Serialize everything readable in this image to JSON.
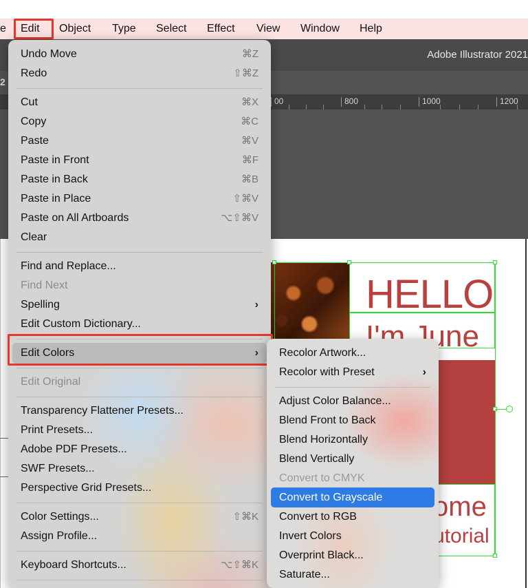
{
  "menubar": {
    "items": [
      {
        "label": "e"
      },
      {
        "label": "Edit"
      },
      {
        "label": "Object"
      },
      {
        "label": "Type"
      },
      {
        "label": "Select"
      },
      {
        "label": "Effect"
      },
      {
        "label": "View"
      },
      {
        "label": "Window"
      },
      {
        "label": "Help"
      }
    ]
  },
  "app": {
    "title": "Adobe Illustrator 2021",
    "tab_fragment": "2",
    "ruler": [
      "00",
      "800",
      "1000",
      "1200"
    ]
  },
  "artwork": {
    "hello": "HELLO",
    "june": "I'm June",
    "welcome": "ome",
    "tutorial": "utorial",
    "accent_color": "#b4403f",
    "selection_color": "#2ee02e"
  },
  "edit_menu": {
    "items": [
      {
        "label": "Undo Move",
        "shortcut": "⌘Z"
      },
      {
        "label": "Redo",
        "shortcut": "⇧⌘Z"
      },
      {
        "label": "Cut",
        "shortcut": "⌘X"
      },
      {
        "label": "Copy",
        "shortcut": "⌘C"
      },
      {
        "label": "Paste",
        "shortcut": "⌘V"
      },
      {
        "label": "Paste in Front",
        "shortcut": "⌘F"
      },
      {
        "label": "Paste in Back",
        "shortcut": "⌘B"
      },
      {
        "label": "Paste in Place",
        "shortcut": "⇧⌘V"
      },
      {
        "label": "Paste on All Artboards",
        "shortcut": "⌥⇧⌘V"
      },
      {
        "label": "Clear",
        "shortcut": ""
      },
      {
        "label": "Find and Replace...",
        "shortcut": ""
      },
      {
        "label": "Find Next",
        "shortcut": ""
      },
      {
        "label": "Spelling",
        "shortcut": ""
      },
      {
        "label": "Edit Custom Dictionary...",
        "shortcut": ""
      },
      {
        "label": "Edit Colors",
        "shortcut": ""
      },
      {
        "label": "Edit Original",
        "shortcut": ""
      },
      {
        "label": "Transparency Flattener Presets...",
        "shortcut": ""
      },
      {
        "label": "Print Presets...",
        "shortcut": ""
      },
      {
        "label": "Adobe PDF Presets...",
        "shortcut": ""
      },
      {
        "label": "SWF Presets...",
        "shortcut": ""
      },
      {
        "label": "Perspective Grid Presets...",
        "shortcut": ""
      },
      {
        "label": "Color Settings...",
        "shortcut": "⇧⌘K"
      },
      {
        "label": "Assign Profile...",
        "shortcut": ""
      },
      {
        "label": "Keyboard Shortcuts...",
        "shortcut": "⌥⇧⌘K"
      }
    ],
    "submenu_arrow": "›"
  },
  "edit_colors_submenu": {
    "items": [
      {
        "label": "Recolor Artwork..."
      },
      {
        "label": "Recolor with Preset"
      },
      {
        "label": "Adjust Color Balance..."
      },
      {
        "label": "Blend Front to Back"
      },
      {
        "label": "Blend Horizontally"
      },
      {
        "label": "Blend Vertically"
      },
      {
        "label": "Convert to CMYK"
      },
      {
        "label": "Convert to Grayscale"
      },
      {
        "label": "Convert to RGB"
      },
      {
        "label": "Invert Colors"
      },
      {
        "label": "Overprint Black..."
      },
      {
        "label": "Saturate..."
      }
    ],
    "highlight_color": "#2f7be5"
  }
}
